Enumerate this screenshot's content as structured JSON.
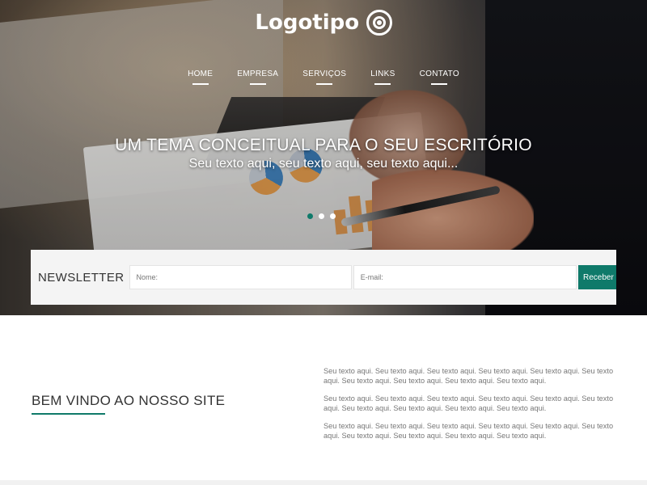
{
  "brand": {
    "logo_text": "Logotipo"
  },
  "nav": {
    "items": [
      {
        "label": "HOME"
      },
      {
        "label": "EMPRESA"
      },
      {
        "label": "SERVIÇOS"
      },
      {
        "label": "LINKS"
      },
      {
        "label": "CONTATO"
      }
    ]
  },
  "hero": {
    "title": "UM TEMA CONCEITUAL PARA O SEU ESCRITÓRIO",
    "subtitle": "Seu texto aqui, seu texto aqui, seu texto aqui...",
    "slides": 3,
    "active_slide": 1
  },
  "newsletter": {
    "label": "NEWSLETTER",
    "name_placeholder": "Nome:",
    "email_placeholder": "E-mail:",
    "button_label": "Receber"
  },
  "welcome": {
    "title": "BEM VINDO AO NOSSO SITE",
    "paragraphs": [
      "Seu texto aqui. Seu texto aqui. Seu texto aqui. Seu texto aqui. Seu texto aqui. Seu texto aqui. Seu texto aqui. Seu texto aqui. Seu texto aqui. Seu texto aqui.",
      "Seu texto aqui. Seu texto aqui. Seu texto aqui. Seu texto aqui. Seu texto aqui. Seu texto aqui. Seu texto aqui. Seu texto aqui. Seu texto aqui. Seu texto aqui.",
      "Seu texto aqui. Seu texto aqui. Seu texto aqui. Seu texto aqui. Seu texto aqui. Seu texto aqui. Seu texto aqui. Seu texto aqui. Seu texto aqui. Seu texto aqui."
    ]
  },
  "colors": {
    "accent": "#0f7a6a",
    "newsletter_bg": "#f4f4f4"
  },
  "icons": {
    "logo_mark": "target-icon"
  }
}
